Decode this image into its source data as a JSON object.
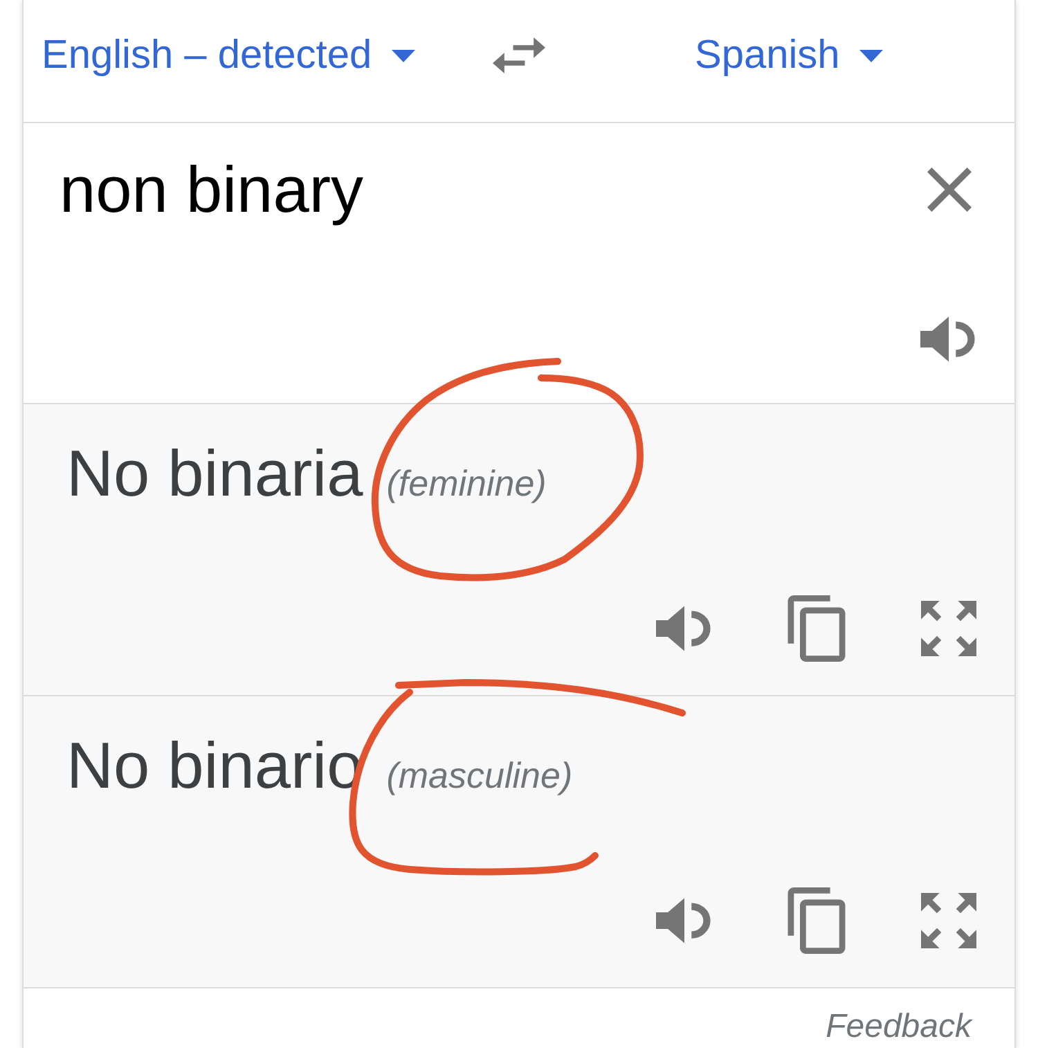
{
  "language_bar": {
    "source": {
      "label": "English – detected"
    },
    "target": {
      "label": "Spanish"
    }
  },
  "input": {
    "value": "non binary"
  },
  "translations": [
    {
      "text": "No binaria",
      "gender": "(feminine)",
      "annotation": {
        "kind": "circle"
      }
    },
    {
      "text": "No binario",
      "gender": "(masculine)",
      "annotation": {
        "kind": "bracket"
      }
    }
  ],
  "footer": {
    "link": "Feedback"
  }
}
